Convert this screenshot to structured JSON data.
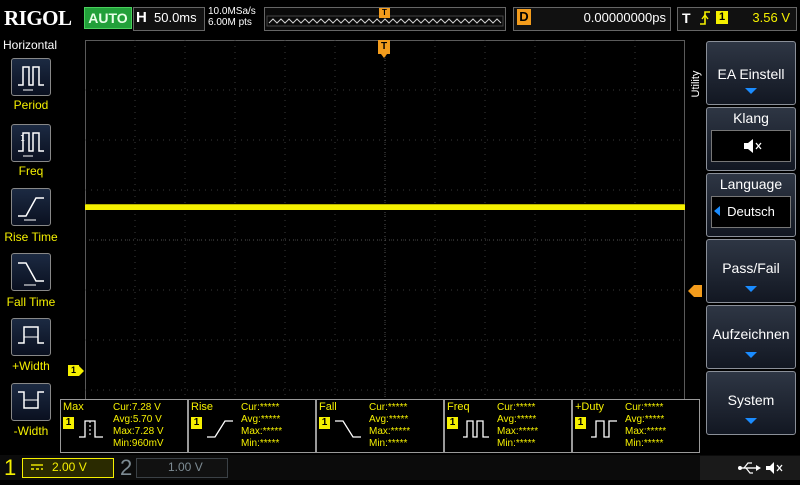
{
  "brand": "RIGOL",
  "run_status": "AUTO",
  "timebase": {
    "letter": "H",
    "value": "50.0ms"
  },
  "acquisition": {
    "sample_rate": "10.0MSa/s",
    "memory_depth": "6.00M pts"
  },
  "trigger_pos_marker": "T",
  "delay": {
    "letter": "D",
    "value": "0.00000000ps"
  },
  "trigger": {
    "letter": "T",
    "channel": "1",
    "level": "3.56 V"
  },
  "left_menu": {
    "title": "Horizontal",
    "items": [
      {
        "label": "Period",
        "icon": "period-icon"
      },
      {
        "label": "Freq",
        "icon": "frequency-icon"
      },
      {
        "label": "Rise Time",
        "icon": "rise-time-icon"
      },
      {
        "label": "Fall Time",
        "icon": "fall-time-icon"
      },
      {
        "label": "+Width",
        "icon": "positive-width-icon"
      },
      {
        "label": "-Width",
        "icon": "negative-width-icon"
      }
    ]
  },
  "right_menu": {
    "tab": "Utility",
    "ea_einstell": "EA Einstell",
    "klang": "Klang",
    "language": "Language",
    "language_value": "Deutsch",
    "pass_fail": "Pass/Fail",
    "aufzeichnen": "Aufzeichnen",
    "system": "System"
  },
  "markers": {
    "ch1_offset": "1"
  },
  "measurements": [
    {
      "name": "Max",
      "channel": "1",
      "lines": [
        "Cur:7.28 V",
        "Avg:5.70 V",
        "Max:7.28 V",
        "Min:960mV"
      ]
    },
    {
      "name": "Rise",
      "channel": "1",
      "lines": [
        "Cur:*****",
        "Avg:*****",
        "Max:*****",
        "Min:*****"
      ]
    },
    {
      "name": "Fall",
      "channel": "1",
      "lines": [
        "Cur:*****",
        "Avg:*****",
        "Max:*****",
        "Min:*****"
      ]
    },
    {
      "name": "Freq",
      "channel": "1",
      "lines": [
        "Cur:*****",
        "Avg:*****",
        "Max:*****",
        "Min:*****"
      ]
    },
    {
      "name": "+Duty",
      "channel": "1",
      "lines": [
        "Cur:*****",
        "Avg:*****",
        "Max:*****",
        "Min:*****"
      ]
    }
  ],
  "channels": {
    "ch1": {
      "number": "1",
      "scale": "2.00 V"
    },
    "ch2": {
      "number": "2",
      "scale": "1.00 V"
    }
  },
  "colors": {
    "ch1": "#f5f000",
    "accent": "#f39c1c",
    "run": "#22a03a",
    "highlight": "#1a8cff"
  }
}
